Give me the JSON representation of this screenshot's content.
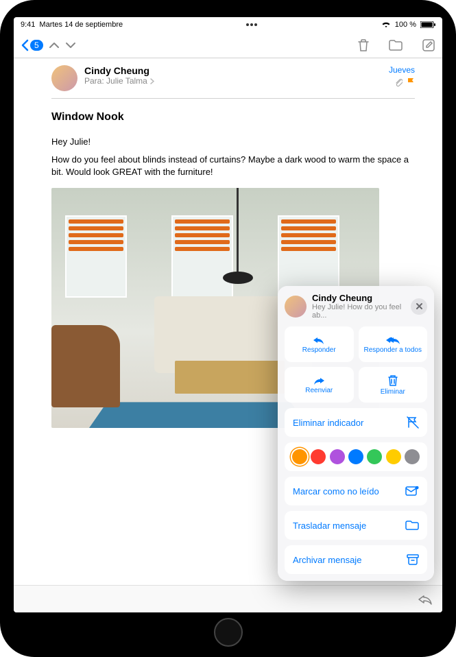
{
  "status_bar": {
    "time": "9:41",
    "date": "Martes 14 de septiembre",
    "battery": "100 %"
  },
  "toolbar": {
    "unread_badge": "5"
  },
  "message": {
    "sender": "Cindy Cheung",
    "to_label": "Para:",
    "recipient": "Julie Talma",
    "date": "Jueves",
    "subject": "Window Nook",
    "greeting": "Hey Julie!",
    "body": "How do you feel about blinds instead of curtains? Maybe a dark wood to warm the space a bit. Would look GREAT with the furniture!"
  },
  "sheet": {
    "sender": "Cindy Cheung",
    "preview": "Hey Julie! How do you feel ab...",
    "reply": "Responder",
    "reply_all": "Responder a todos",
    "forward": "Reenviar",
    "delete": "Eliminar",
    "remove_flag": "Eliminar indicador",
    "mark_unread": "Marcar como no leído",
    "move_msg": "Trasladar mensaje",
    "archive_msg": "Archivar mensaje",
    "flag_colors": [
      "#ff9500",
      "#ff3b30",
      "#af52de",
      "#007aff",
      "#34c759",
      "#ffcc00",
      "#8e8e93"
    ]
  }
}
